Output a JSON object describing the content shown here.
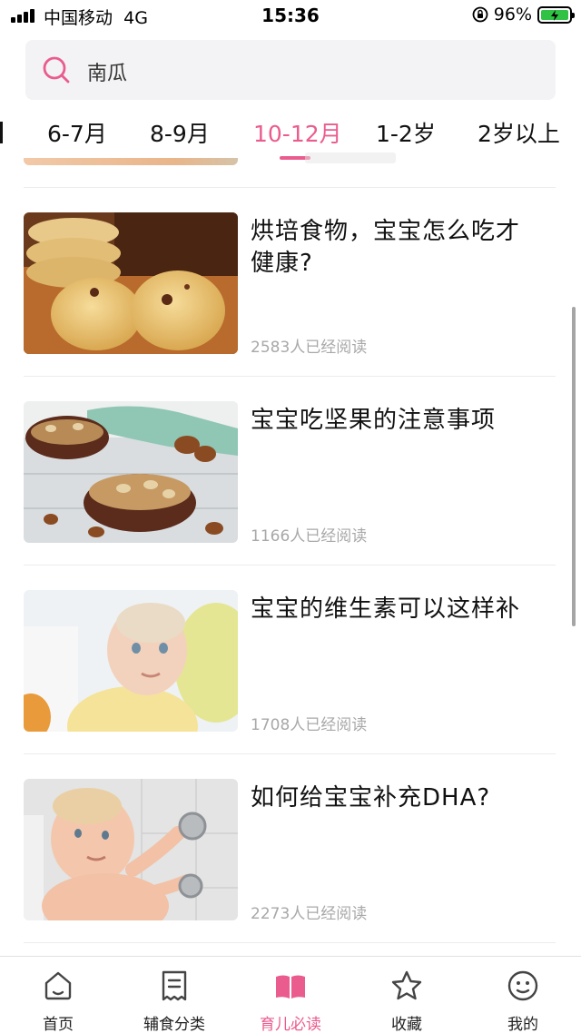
{
  "status_bar": {
    "carrier": "中国移动",
    "network": "4G",
    "time": "15:36",
    "battery_percent": "96%"
  },
  "search": {
    "icon": "search-icon",
    "text": "南瓜"
  },
  "age_tabs": [
    {
      "label": "6-7月",
      "active": false
    },
    {
      "label": "8-9月",
      "active": false
    },
    {
      "label": "10-12月",
      "active": true
    },
    {
      "label": "1-2岁",
      "active": false
    },
    {
      "label": "2岁以上",
      "active": false
    }
  ],
  "articles": [
    {
      "title": "烘培食物，宝宝怎么吃才健康?",
      "reads": "2583人已经阅读",
      "image": "baked-cookies-photo"
    },
    {
      "title": " 宝宝吃坚果的注意事项",
      "reads": "1166人已经阅读",
      "image": "nuts-bowl-photo"
    },
    {
      "title": "宝宝的维生素可以这样补",
      "reads": "1708人已经阅读",
      "image": "baby-portrait-photo"
    },
    {
      "title": "如何给宝宝补充DHA?",
      "reads": "2273人已经阅读",
      "image": "baby-bath-photo"
    }
  ],
  "bottom_nav": [
    {
      "label": "首页",
      "icon": "home-icon"
    },
    {
      "label": "辅食分类",
      "icon": "receipt-icon"
    },
    {
      "label": "育儿必读",
      "icon": "book-icon",
      "active": true
    },
    {
      "label": "收藏",
      "icon": "star-icon"
    },
    {
      "label": "我的",
      "icon": "smiley-icon"
    }
  ],
  "colors": {
    "accent": "#ea5c8e",
    "text": "#111111",
    "muted": "#a8a8a8",
    "search_bg": "#f3f3f5"
  }
}
